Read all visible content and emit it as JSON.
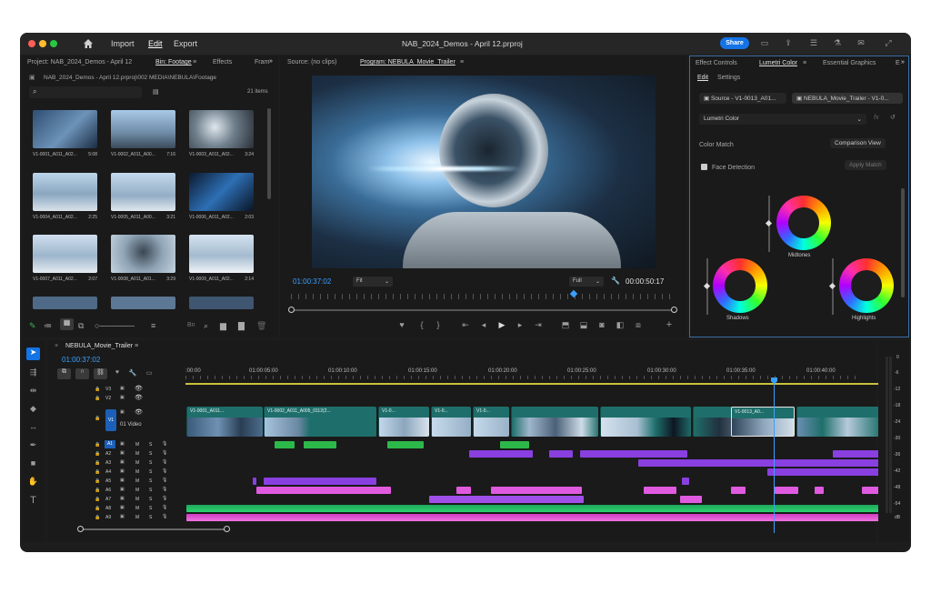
{
  "menu": {
    "import": "Import",
    "edit": "Edit",
    "export": "Export",
    "title": "NAB_2024_Demos - April 12.prproj",
    "share": "Share"
  },
  "project": {
    "tabs": [
      "Project: NAB_2024_Demos - April 12",
      "Bin: Footage",
      "Effects",
      "Fram"
    ],
    "path": "NAB_2024_Demos - April 12.prproj\\002 MEDIA\\NEBULA\\Footage",
    "item_count": "21 items",
    "items": [
      {
        "name": "V1-0001_A011_A02...",
        "dur": "5:08"
      },
      {
        "name": "V1-0002_A011_A00...",
        "dur": "7:16"
      },
      {
        "name": "V1-0003_A011_A02...",
        "dur": "3:24"
      },
      {
        "name": "V1-0004_A011_A02...",
        "dur": "2:25"
      },
      {
        "name": "V1-0005_A011_A00...",
        "dur": "3:21"
      },
      {
        "name": "V1-0006_A011_A02...",
        "dur": "2:03"
      },
      {
        "name": "V1-0007_A011_A02...",
        "dur": "2:07"
      },
      {
        "name": "V1-0008_A011_A01...",
        "dur": "3:29"
      },
      {
        "name": "V1-0009_A011_A02...",
        "dur": "2:14"
      }
    ]
  },
  "monitor": {
    "source_tab": "Source: (no clips)",
    "program_tab": "Program: NEBULA_Movie_Trailer",
    "timecode": "01:00:37:02",
    "fit": "Fit",
    "quality": "Full",
    "duration": "00:00:50:17"
  },
  "lumetri": {
    "tabs": [
      "Effect Controls",
      "Lumetri Color",
      "Essential Graphics",
      "E"
    ],
    "subtabs": [
      "Edit",
      "Settings"
    ],
    "source_btn": "Source - V1-0013_A01...",
    "seq_btn": "NEBULA_Movie_Trailer - V1-0...",
    "effect": "Lumetri Color",
    "color_match": "Color Match",
    "comparison": "Comparison View",
    "face": "Face Detection",
    "apply": "Apply Match",
    "midtones": "Midtones",
    "shadows": "Shadows",
    "highlights": "Highlights"
  },
  "timeline": {
    "tab": "NEBULA_Movie_Trailer",
    "timecode": "01:00:37:02",
    "ruler": [
      ":00:00",
      "01:00:05:00",
      "01:00:10:00",
      "01:00:15:00",
      "01:00:20:00",
      "01:00:25:00",
      "01:00:30:00",
      "01:00:35:00",
      "01:00:40:00"
    ],
    "vtracks": [
      "V3",
      "V2",
      "V1"
    ],
    "v1_name": "01 Video",
    "atracks": [
      "A1",
      "A2",
      "A3",
      "A4",
      "A5",
      "A6",
      "A7",
      "A8",
      "A9"
    ],
    "clips": [
      "V1-0001_A011...",
      "V1-0002_A011_A005_0112(2...",
      "V1-0...",
      "V1-0...",
      "V1-0...",
      "V1-0013_A0..."
    ]
  },
  "meter": {
    "labels": [
      "0",
      "-6",
      "-12",
      "-18",
      "-24",
      "-30",
      "-36",
      "-42",
      "-48",
      "-54",
      "dB"
    ]
  }
}
